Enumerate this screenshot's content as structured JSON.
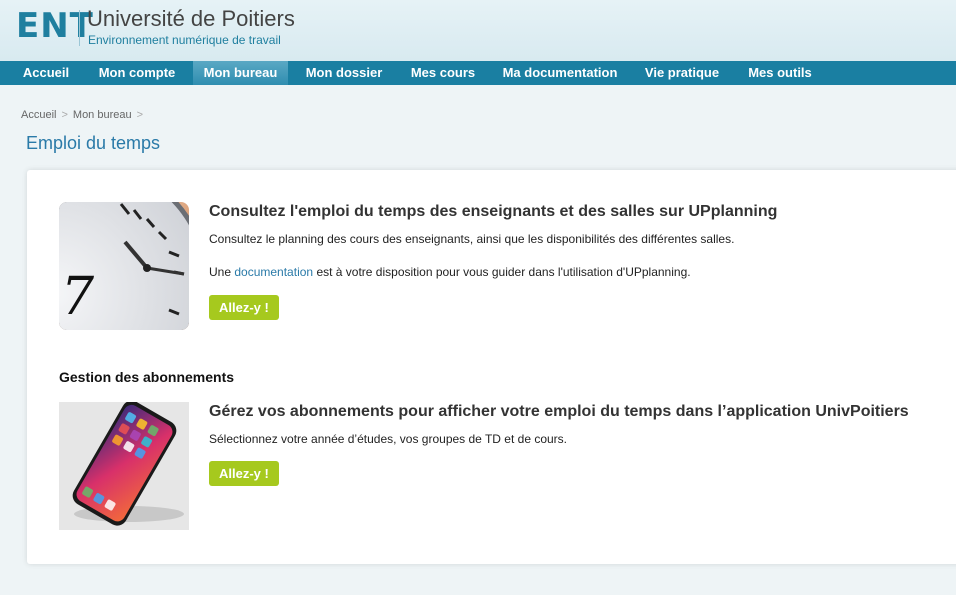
{
  "header": {
    "logo_ent": "ENT",
    "university": "Université de Poitiers",
    "subtitle": "Environnement numérique de travail"
  },
  "nav": {
    "items": [
      {
        "label": "Accueil"
      },
      {
        "label": "Mon compte"
      },
      {
        "label": "Mon bureau",
        "active": true
      },
      {
        "label": "Mon dossier"
      },
      {
        "label": "Mes cours"
      },
      {
        "label": "Ma documentation"
      },
      {
        "label": "Vie pratique"
      },
      {
        "label": "Mes outils"
      }
    ]
  },
  "breadcrumb": {
    "items": [
      "Accueil",
      "Mon bureau"
    ],
    "separator": ">"
  },
  "page_title": "Emploi du temps",
  "card1": {
    "title": "Consultez l'emploi du temps des enseignants et des salles sur UPplanning",
    "desc": "Consultez le planning des cours des enseignants, ainsi que les disponibilités des différentes salles.",
    "doc_prefix": "Une",
    "doc_link": "documentation",
    "doc_suffix": "est à votre disposition pour vous guider dans l'utilisation d'UPplanning.",
    "button": "Allez-y !",
    "image_icon": "clock-image"
  },
  "section2_title": "Gestion des abonnements",
  "card2": {
    "title": "Gérez vos abonnements pour afficher votre emploi du temps dans l’application UnivPoitiers",
    "desc": "Sélectionnez votre année d’études, vos groupes de TD et de cours.",
    "button": "Allez-y !",
    "image_icon": "smartphone-image"
  },
  "colors": {
    "brand": "#1a7fa2",
    "button": "#a6c91e",
    "title": "#2a7aa8"
  }
}
